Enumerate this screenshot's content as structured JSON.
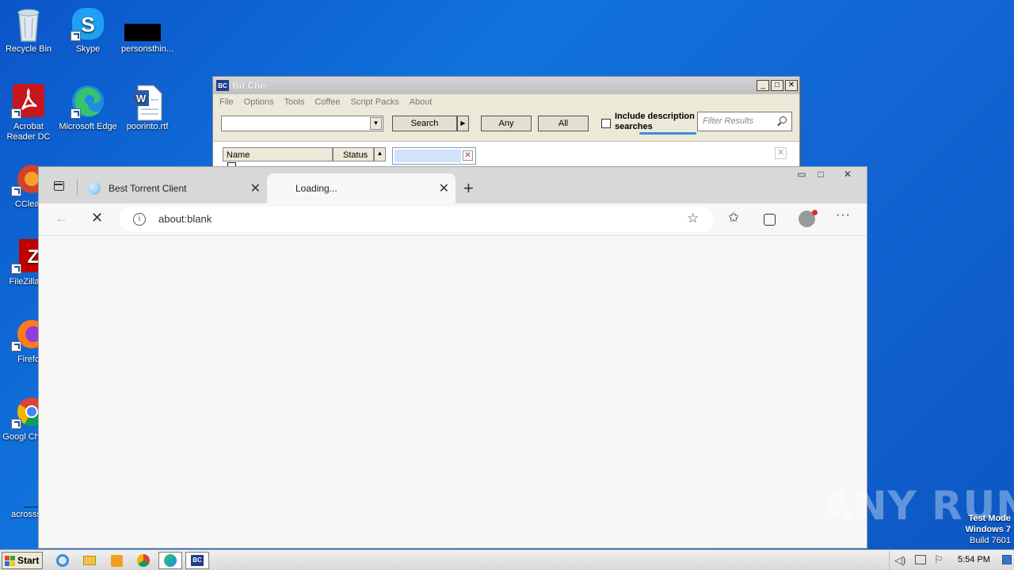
{
  "desktop": {
    "icons": [
      {
        "label": "Recycle Bin"
      },
      {
        "label": "Skype"
      },
      {
        "label": "personsthin..."
      },
      {
        "label": "Acrobat Reader DC"
      },
      {
        "label": "Microsoft Edge"
      },
      {
        "label": "poorinto.rtf"
      },
      {
        "label": "CClear"
      },
      {
        "label": "FileZilla C"
      },
      {
        "label": "Firefo"
      },
      {
        "label": "Googl Chrom"
      },
      {
        "label": "acrosssp"
      }
    ]
  },
  "bitche": {
    "title": "Bit Che",
    "menu": [
      "File",
      "Options",
      "Tools",
      "Coffee",
      "Script Packs",
      "About"
    ],
    "search_label": "Search",
    "any_label": "Any",
    "all_label": "All",
    "include_desc_label": "Include description searches",
    "filter_placeholder": "Filter Results",
    "columns": [
      "Name",
      "Status"
    ]
  },
  "edge": {
    "tabs": [
      {
        "label": "Best Torrent Client"
      },
      {
        "label": "Loading..."
      }
    ],
    "url": "about:blank"
  },
  "taskbar": {
    "start_label": "Start",
    "clock": "5:54 PM"
  },
  "watermark": {
    "text": "ANY RUN",
    "test_mode": "Test Mode",
    "windows": "Windows 7",
    "build": "Build 7601"
  }
}
